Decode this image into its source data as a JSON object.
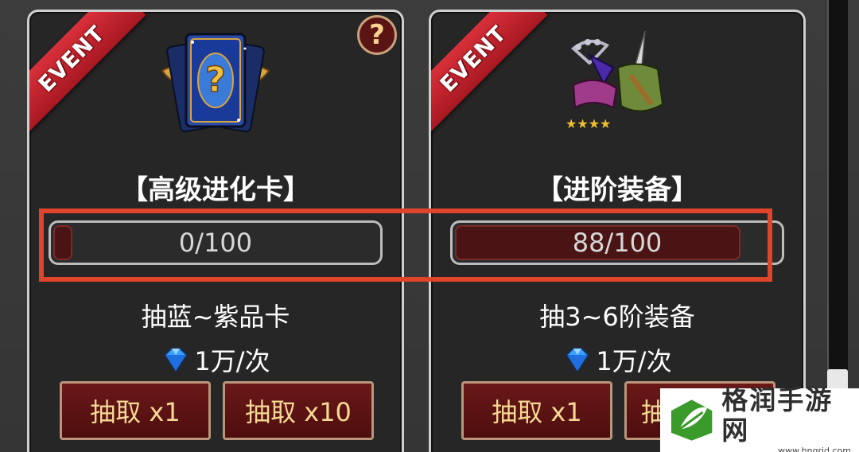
{
  "cards": [
    {
      "ribbon": "EVENT",
      "help_glyph": "?",
      "title": "【高级进化卡】",
      "progress_text": "0/100",
      "progress_value": 0,
      "desc": "抽蓝~紫品卡",
      "cost": "1万/次",
      "btn1": "抽取 x1",
      "btn2": "抽取 x10"
    },
    {
      "ribbon": "EVENT",
      "title": "【进阶装备】",
      "progress_text": "88/100",
      "progress_value": 0.88,
      "desc": "抽3~6阶装备",
      "cost": "1万/次",
      "btn1": "抽取 x1",
      "btn2": "抽"
    }
  ],
  "watermark": {
    "name": "格润手游网",
    "url": "www.hngrjd.com"
  },
  "icons": {
    "cost_icon": "diamond-icon",
    "card_art": "mystery-card-icon",
    "equip_art": "equipment-set-icon"
  },
  "colors": {
    "ribbon": "#c8222c",
    "button_bg": "#5c1212",
    "button_text": "#f6d995",
    "highlight": "#e0442a"
  }
}
